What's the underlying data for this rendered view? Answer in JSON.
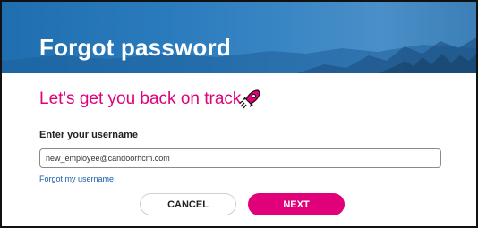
{
  "header": {
    "title": "Forgot password"
  },
  "main": {
    "tagline": "Let's get you back on track",
    "username_label": "Enter your username",
    "username_value": "new_employee@candoorhcm.com",
    "forgot_username_link": "Forgot my username"
  },
  "buttons": {
    "cancel": "CANCEL",
    "next": "NEXT"
  },
  "colors": {
    "accent": "#e0007a",
    "link": "#1a5fa6",
    "hero": "#2a7bbd"
  },
  "icons": {
    "tagline_icon": "rocket-icon"
  }
}
